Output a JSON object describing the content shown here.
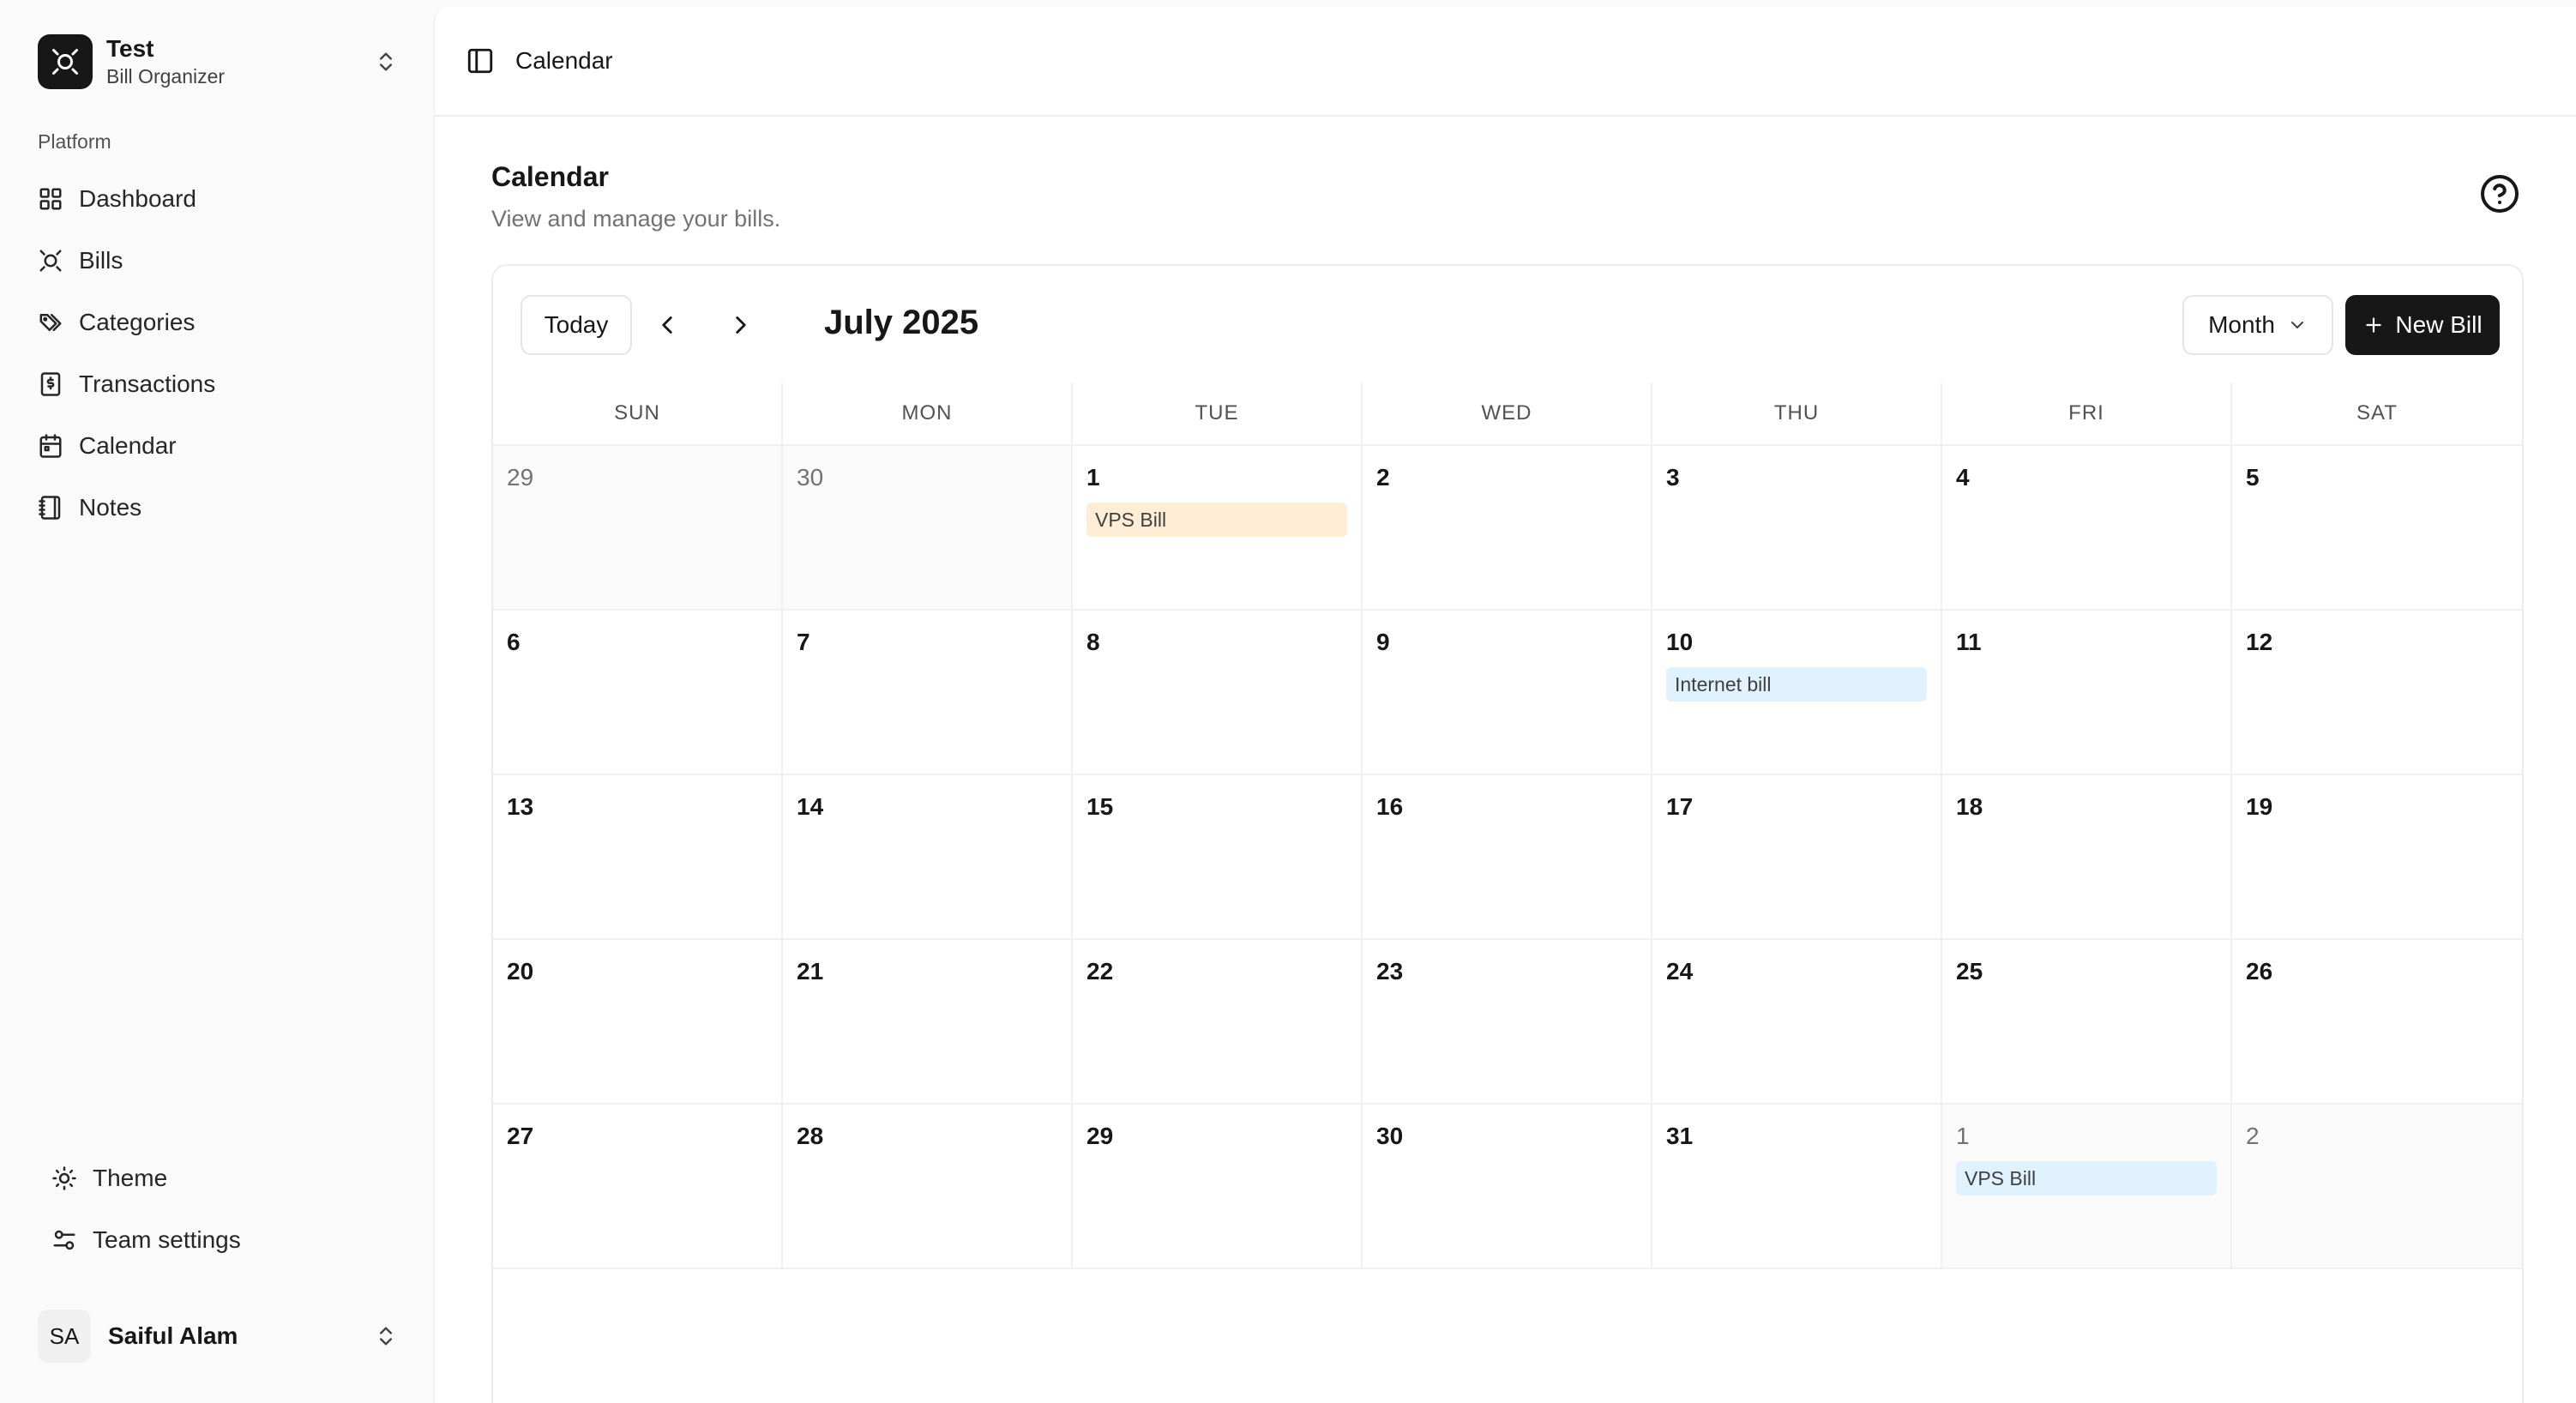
{
  "team": {
    "name": "Test",
    "subtitle": "Bill Organizer"
  },
  "sidebar": {
    "group_label": "Platform",
    "items": [
      {
        "label": "Dashboard",
        "icon": "grid-icon"
      },
      {
        "label": "Bills",
        "icon": "bill-icon"
      },
      {
        "label": "Categories",
        "icon": "tags-icon"
      },
      {
        "label": "Transactions",
        "icon": "receipt-icon"
      },
      {
        "label": "Calendar",
        "icon": "calendar-icon"
      },
      {
        "label": "Notes",
        "icon": "notebook-icon"
      }
    ],
    "footer": [
      {
        "label": "Theme",
        "icon": "sun-icon"
      },
      {
        "label": "Team settings",
        "icon": "settings-sliders-icon"
      }
    ]
  },
  "user": {
    "initials": "SA",
    "name": "Saiful Alam"
  },
  "topbar": {
    "title": "Calendar"
  },
  "page": {
    "title": "Calendar",
    "subtitle": "View and manage your bills."
  },
  "calendar": {
    "today_label": "Today",
    "month_label": "July 2025",
    "view_label": "Month",
    "new_bill_label": "New Bill",
    "weekdays": [
      "SUN",
      "MON",
      "TUE",
      "WED",
      "THU",
      "FRI",
      "SAT"
    ],
    "weeks": [
      [
        {
          "day": "29",
          "outside": true
        },
        {
          "day": "30",
          "outside": true
        },
        {
          "day": "1",
          "events": [
            {
              "title": "VPS Bill",
              "color": "orange"
            }
          ]
        },
        {
          "day": "2"
        },
        {
          "day": "3"
        },
        {
          "day": "4"
        },
        {
          "day": "5"
        }
      ],
      [
        {
          "day": "6"
        },
        {
          "day": "7"
        },
        {
          "day": "8"
        },
        {
          "day": "9"
        },
        {
          "day": "10",
          "events": [
            {
              "title": "Internet bill",
              "color": "blue"
            }
          ]
        },
        {
          "day": "11"
        },
        {
          "day": "12"
        }
      ],
      [
        {
          "day": "13"
        },
        {
          "day": "14"
        },
        {
          "day": "15"
        },
        {
          "day": "16"
        },
        {
          "day": "17"
        },
        {
          "day": "18"
        },
        {
          "day": "19"
        }
      ],
      [
        {
          "day": "20"
        },
        {
          "day": "21"
        },
        {
          "day": "22"
        },
        {
          "day": "23"
        },
        {
          "day": "24"
        },
        {
          "day": "25"
        },
        {
          "day": "26"
        }
      ],
      [
        {
          "day": "27"
        },
        {
          "day": "28"
        },
        {
          "day": "29"
        },
        {
          "day": "30"
        },
        {
          "day": "31"
        },
        {
          "day": "1",
          "outside": true,
          "events": [
            {
              "title": "VPS Bill",
              "color": "blue"
            }
          ]
        },
        {
          "day": "2",
          "outside": true
        }
      ]
    ]
  },
  "colors": {
    "primary": "#171717",
    "event_orange": "#ffedd5",
    "event_blue": "#e0f2fe"
  }
}
